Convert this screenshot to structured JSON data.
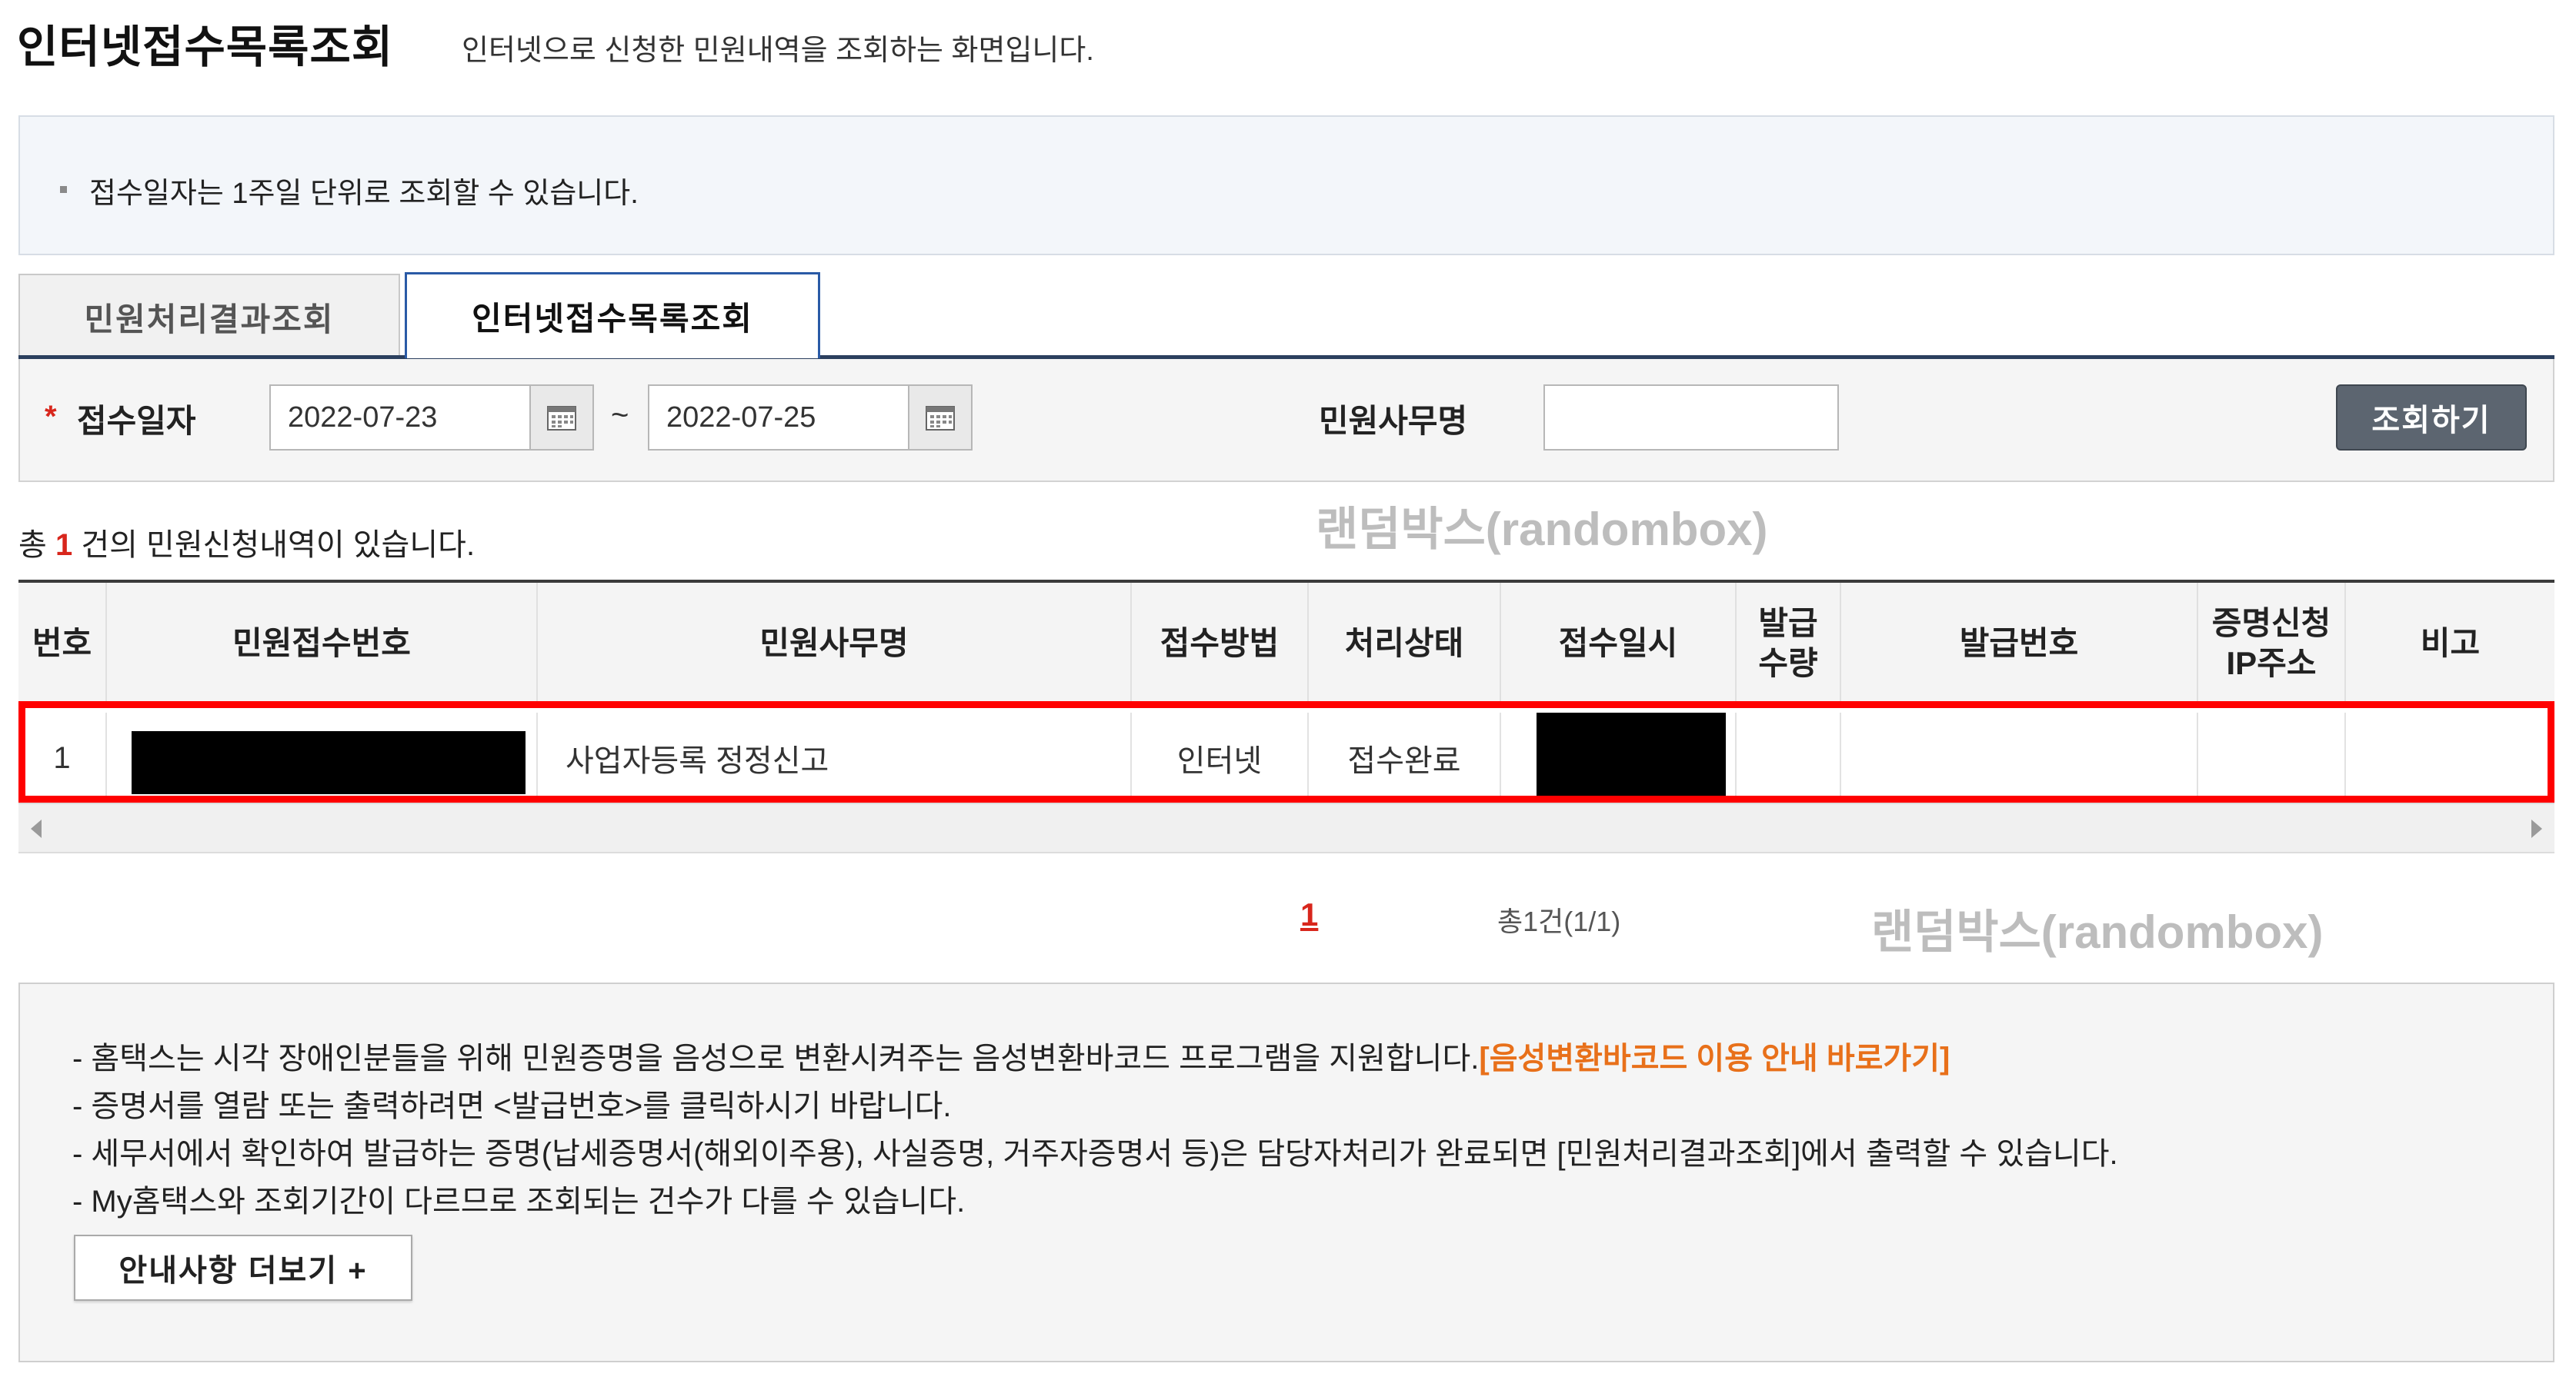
{
  "header": {
    "title": "인터넷접수목록조회",
    "description": "인터넷으로 신청한 민원내역을 조회하는 화면입니다."
  },
  "info": {
    "note": "접수일자는 1주일 단위로 조회할 수 있습니다."
  },
  "tabs": [
    {
      "label": "민원처리결과조회",
      "active": false
    },
    {
      "label": "인터넷접수목록조회",
      "active": true
    }
  ],
  "search": {
    "date_label": "접수일자",
    "required_mark": "*",
    "date_from": "2022-07-23",
    "date_to": "2022-07-25",
    "separator": "~",
    "name_label": "민원사무명",
    "name_value": "",
    "button_label": "조회하기"
  },
  "watermark": "랜덤박스(randombox)",
  "summary": {
    "prefix": "총",
    "count": "1",
    "suffix": "건의 민원신청내역이 있습니다."
  },
  "table": {
    "headers": [
      "번호",
      "민원접수번호",
      "민원사무명",
      "접수방법",
      "처리상태",
      "접수일시",
      "발급\n수량",
      "발급번호",
      "증명신청\nIP주소",
      "비고"
    ],
    "rows": [
      {
        "no": "1",
        "receipt_no": "",
        "name": "사업자등록 정정신고",
        "method": "인터넷",
        "status": "접수완료",
        "datetime": "",
        "qty": "",
        "issue_no": "",
        "ip": "",
        "note": ""
      }
    ]
  },
  "pagination": {
    "current": "1",
    "total_text": "총1건(1/1)"
  },
  "guide": {
    "lines": [
      "- 홈택스는 시각 장애인분들을 위해 민원증명을 음성으로 변환시켜주는 음성변환바코드 프로그램을 지원합니다.",
      "- 증명서를 열람 또는 출력하려면 <발급번호>를 클릭하시기 바랍니다.",
      "- 세무서에서 확인하여 발급하는 증명(납세증명서(해외이주용), 사실증명, 거주자증명서 등)은 담당자처리가 완료되면 [민원처리결과조회]에서 출력할 수 있습니다.",
      "- My홈택스와 조회기간이 다르므로 조회되는 건수가 다를 수 있습니다."
    ],
    "link_text": "[음성변환바코드 이용 안내 바로가기]",
    "more_button": "안내사항 더보기 +"
  },
  "colors": {
    "accent_red": "#d8261c",
    "highlight_red": "#ff0000",
    "link_orange": "#e8701a",
    "tab_border_blue": "#2a5aa6",
    "button_gray": "#5c6570"
  },
  "icons": {
    "calendar": "calendar-icon",
    "scroll_left": "arrow-left-icon",
    "scroll_right": "arrow-right-icon"
  }
}
